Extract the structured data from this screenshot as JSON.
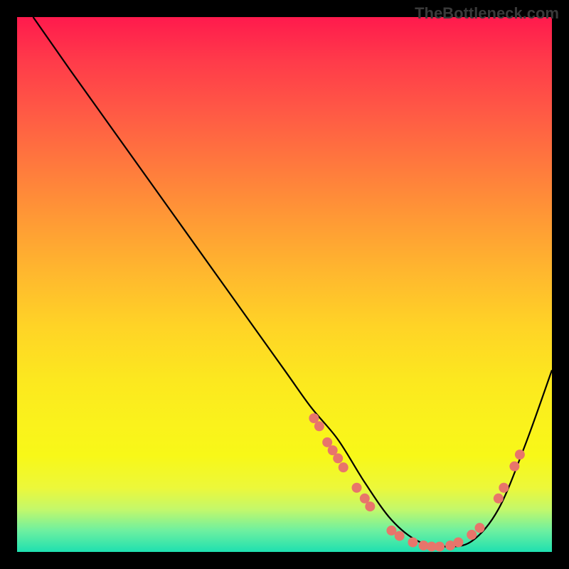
{
  "watermark": "TheBottleneck.com",
  "chart_data": {
    "type": "line",
    "title": "",
    "xlabel": "",
    "ylabel": "",
    "xlim": [
      0,
      100
    ],
    "ylim": [
      0,
      100
    ],
    "grid": false,
    "legend": false,
    "series": [
      {
        "name": "curve",
        "x": [
          3,
          10,
          20,
          30,
          40,
          50,
          55,
          60,
          65,
          70,
          75,
          80,
          85,
          90,
          95,
          100
        ],
        "y": [
          100,
          90,
          76,
          62,
          48,
          34,
          27,
          21,
          13,
          6,
          2,
          1,
          2,
          8,
          20,
          34
        ]
      }
    ],
    "markers": [
      {
        "x": 55.5,
        "y": 25
      },
      {
        "x": 56.5,
        "y": 23.5
      },
      {
        "x": 58,
        "y": 20.5
      },
      {
        "x": 59,
        "y": 19
      },
      {
        "x": 60,
        "y": 17.5
      },
      {
        "x": 61,
        "y": 15.8
      },
      {
        "x": 63.5,
        "y": 12
      },
      {
        "x": 65,
        "y": 10
      },
      {
        "x": 66,
        "y": 8.5
      },
      {
        "x": 70,
        "y": 4
      },
      {
        "x": 71.5,
        "y": 3
      },
      {
        "x": 74,
        "y": 1.8
      },
      {
        "x": 76,
        "y": 1.2
      },
      {
        "x": 77.5,
        "y": 1
      },
      {
        "x": 79,
        "y": 1
      },
      {
        "x": 81,
        "y": 1.2
      },
      {
        "x": 82.5,
        "y": 1.8
      },
      {
        "x": 85,
        "y": 3.2
      },
      {
        "x": 86.5,
        "y": 4.5
      },
      {
        "x": 90,
        "y": 10
      },
      {
        "x": 91,
        "y": 12
      },
      {
        "x": 93,
        "y": 16
      },
      {
        "x": 94,
        "y": 18.2
      }
    ],
    "marker_style": {
      "color": "#e8756b",
      "radius": 7
    }
  }
}
